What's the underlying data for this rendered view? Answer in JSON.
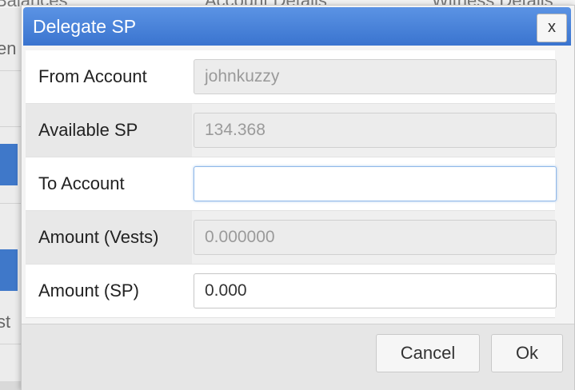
{
  "background": {
    "tabs": [
      "Balances",
      "Account Details",
      "Witness Details"
    ],
    "left_fragments": [
      "en",
      "st"
    ]
  },
  "dialog": {
    "title": "Delegate SP",
    "close_label": "x",
    "fields": [
      {
        "label": "From Account",
        "value": "johnkuzzy",
        "placeholder": "",
        "editable": false
      },
      {
        "label": "Available SP",
        "value": "134.368",
        "placeholder": "",
        "editable": false
      },
      {
        "label": "To Account",
        "value": "",
        "placeholder": "",
        "editable": true
      },
      {
        "label": "Amount (Vests)",
        "value": "0.000000",
        "placeholder": "",
        "editable": false
      },
      {
        "label": "Amount (SP)",
        "value": "0.000",
        "placeholder": "",
        "editable": true
      }
    ],
    "cancel_label": "Cancel",
    "ok_label": "Ok"
  },
  "colors": {
    "titlebar": "#3a74cf",
    "focus_border": "#8fb8e8"
  }
}
